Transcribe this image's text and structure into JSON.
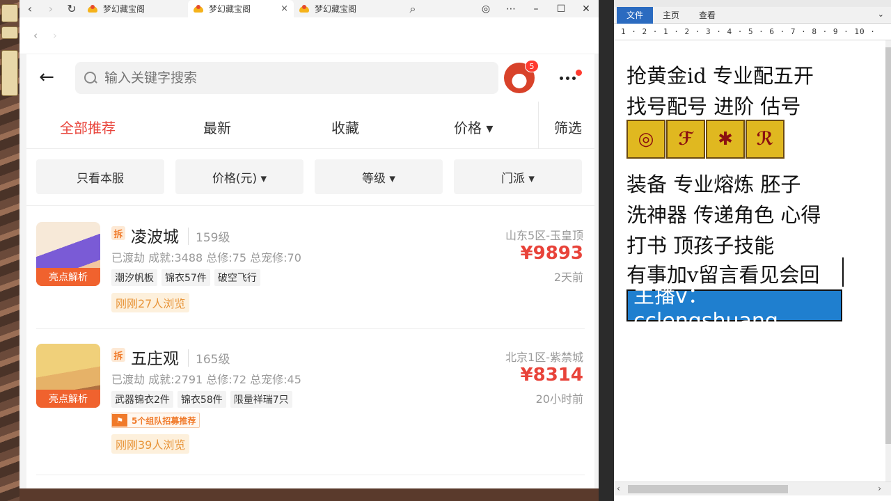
{
  "browser": {
    "tabs": [
      {
        "title": "梦幻藏宝阁"
      },
      {
        "title": "梦幻藏宝阁"
      },
      {
        "title": "梦幻藏宝阁"
      }
    ],
    "close_symbol": "×"
  },
  "page": {
    "search": {
      "placeholder": "输入关键字搜索"
    },
    "badge_count": "5",
    "tabs": [
      {
        "label": "全部推荐"
      },
      {
        "label": "最新"
      },
      {
        "label": "收藏"
      },
      {
        "label": "价格 ▾"
      },
      {
        "label": "筛选"
      }
    ],
    "filters": [
      {
        "label": "只看本服"
      },
      {
        "label": "价格(元) ▾"
      },
      {
        "label": "等级 ▾"
      },
      {
        "label": "门派 ▾"
      }
    ],
    "items": [
      {
        "badge": "拆",
        "name": "凌波城",
        "level": "159级",
        "stats": "已渡劫 成就:3488 总修:75 总宠修:70",
        "tags": [
          "潮汐帆板",
          "锦衣57件",
          "破空飞行"
        ],
        "highlight_label": "亮点解析",
        "views": "刚刚27人浏览",
        "server": "山东5区-玉皇顶",
        "price": "¥9893",
        "time": "2天前"
      },
      {
        "badge": "拆",
        "name": "五庄观",
        "level": "165级",
        "stats": "已渡劫 成就:2791 总修:72 总宠修:45",
        "tags": [
          "武器锦衣2件",
          "锦衣58件",
          "限量祥瑞7只"
        ],
        "highlight_label": "亮点解析",
        "recruit": "5个组队招募推荐",
        "views": "刚刚39人浏览",
        "server": "北京1区-紫禁城",
        "price": "¥8314",
        "time": "20小时前"
      }
    ]
  },
  "word": {
    "ribbon": [
      {
        "label": "文件"
      },
      {
        "label": "主页"
      },
      {
        "label": "查看"
      }
    ],
    "ruler": "1 · 2 · 1 · 2 · 3 · 4 · 5 · 6 · 7 · 8 · 9 · 10 ·",
    "lines": [
      "抢黄金id 专业配五开",
      "找号配号 进阶 估号",
      "装备 专业熔炼 胚子",
      "洗神器 传递角色 心得",
      "打书 顶孩子技能",
      "有事加v留言看见会回"
    ],
    "host": "主播v：cclengshuang"
  }
}
